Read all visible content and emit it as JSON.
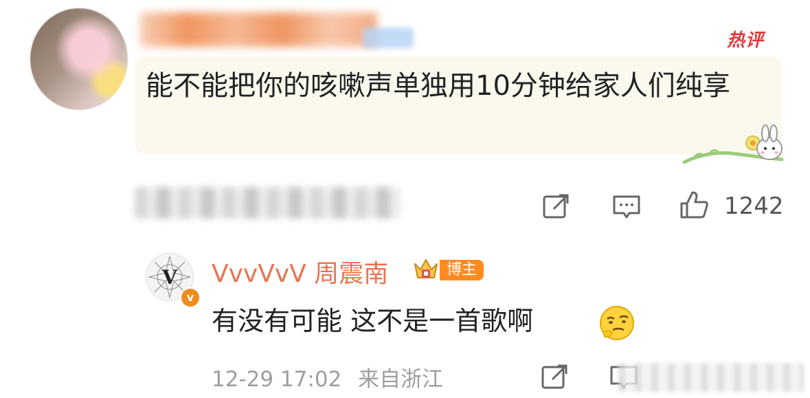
{
  "top_comment": {
    "hot_tag": "热评",
    "text": "能不能把你的咳嗽声单独用10分钟给家人们纯享",
    "actions": {
      "like_count": "1242"
    }
  },
  "reply": {
    "author": "VvvVvV 周震南",
    "verified_badge": "v",
    "role_tag": "博主",
    "text": "有没有可能 这不是一首歌啊",
    "emoji": "thinking-face",
    "timestamp": "12-29 17:02",
    "location": "来自浙江"
  },
  "colors": {
    "accent_name": "#eb7350",
    "hot_red": "#e4393c",
    "bubble_bg": "#fbf9ee",
    "blogger_tag": "#ff8a1f",
    "meta_gray": "#9e9e9e"
  },
  "icons": [
    "share-icon",
    "comment-icon",
    "like-icon",
    "crown-icon",
    "thinking-face-emoji"
  ]
}
